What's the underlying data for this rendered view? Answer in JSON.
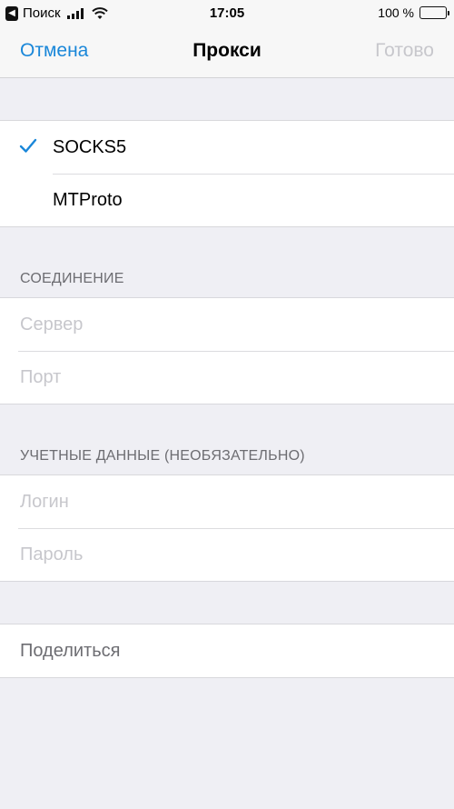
{
  "status_bar": {
    "back_app_label": "Поиск",
    "time": "17:05",
    "battery_percent": "100 %"
  },
  "nav": {
    "cancel": "Отмена",
    "title": "Прокси",
    "done": "Готово"
  },
  "proxy_types": [
    {
      "label": "SOCKS5",
      "selected": true
    },
    {
      "label": "MTProto",
      "selected": false
    }
  ],
  "connection": {
    "header": "СОЕДИНЕНИЕ",
    "server_placeholder": "Сервер",
    "port_placeholder": "Порт"
  },
  "credentials": {
    "header": "УЧЕТНЫЕ ДАННЫЕ (НЕОБЯЗАТЕЛЬНО)",
    "login_placeholder": "Логин",
    "password_placeholder": "Пароль"
  },
  "share": {
    "label": "Поделиться"
  },
  "colors": {
    "accent": "#1a87d9",
    "background": "#efeff4",
    "placeholder": "#c7c7cc",
    "section_header": "#6d6d72"
  }
}
